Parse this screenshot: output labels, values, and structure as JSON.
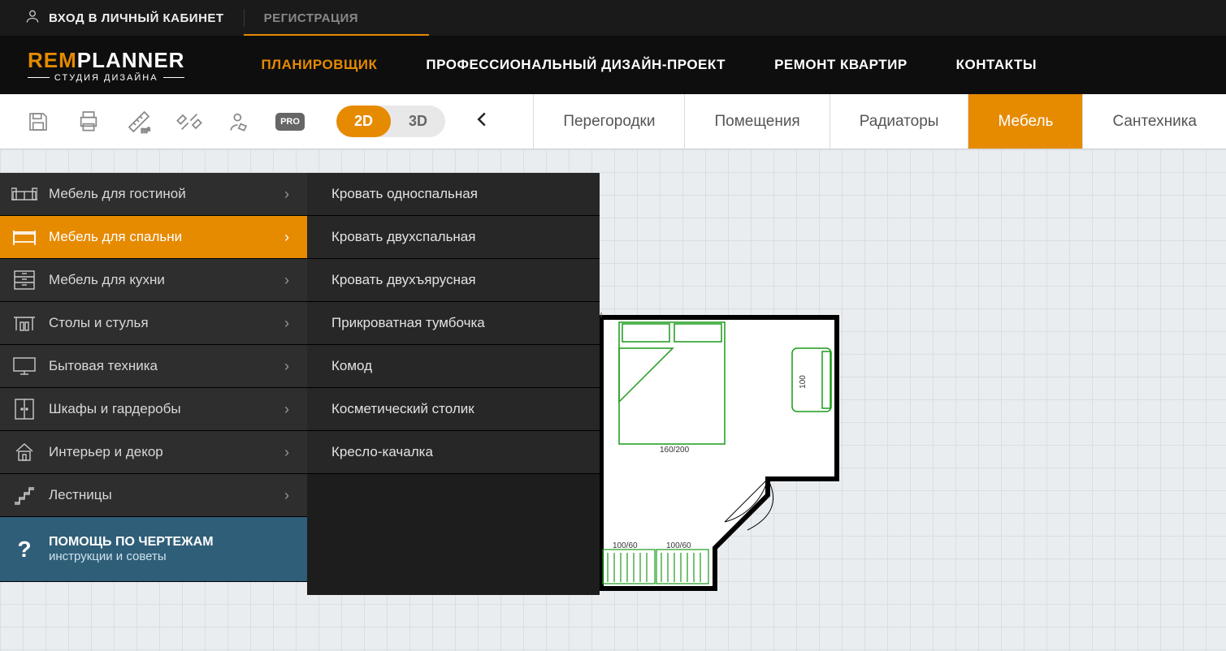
{
  "auth": {
    "login": "ВХОД В ЛИЧНЫЙ КАБИНЕТ",
    "register": "РЕГИСТРАЦИЯ"
  },
  "logo": {
    "prefix": "REM",
    "suffix": "PLANNER",
    "tagline": "СТУДИЯ ДИЗАЙНА"
  },
  "nav": {
    "items": [
      "ПЛАНИРОВЩИК",
      "ПРОФЕССИОНАЛЬНЫЙ ДИЗАЙН-ПРОЕКТ",
      "РЕМОНТ КВАРТИР",
      "КОНТАКТЫ"
    ],
    "activeIndex": 0
  },
  "toolbar": {
    "pro": "PRO",
    "dim2d": "2D",
    "dim3d": "3D",
    "tabs": [
      "Перегородки",
      "Помещения",
      "Радиаторы",
      "Мебель",
      "Сантехника"
    ],
    "activeTab": 3
  },
  "menu": {
    "categories": [
      {
        "label": "Мебель для гостиной"
      },
      {
        "label": "Мебель для спальни"
      },
      {
        "label": "Мебель для кухни"
      },
      {
        "label": "Столы и стулья"
      },
      {
        "label": "Бытовая техника"
      },
      {
        "label": "Шкафы и гардеробы"
      },
      {
        "label": "Интерьер и декор"
      },
      {
        "label": "Лестницы"
      }
    ],
    "activeCategory": 1,
    "help": {
      "title": "ПОМОЩЬ ПО ЧЕРТЕЖАМ",
      "subtitle": "инструкции и советы"
    },
    "submenu": [
      "Кровать односпальная",
      "Кровать двухспальная",
      "Кровать двухъярусная",
      "Прикроватная тумбочка",
      "Комод",
      "Косметический столик",
      "Кресло-качалка"
    ]
  },
  "floorplan": {
    "bedLabel": "160/200",
    "wardrobe1": "100/60",
    "wardrobe2": "100/60",
    "sofaLabel": "100"
  }
}
